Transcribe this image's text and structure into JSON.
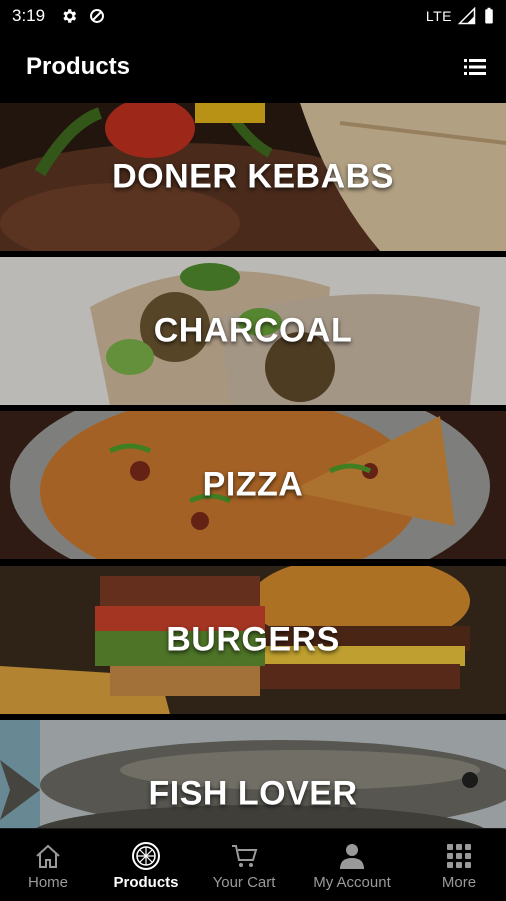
{
  "status": {
    "time": "3:19",
    "network": "LTE"
  },
  "appbar": {
    "title": "Products"
  },
  "categories": [
    {
      "label": "DONER KEBABS"
    },
    {
      "label": "CHARCOAL"
    },
    {
      "label": "PIZZA"
    },
    {
      "label": "BURGERS"
    },
    {
      "label": "FISH LOVER"
    }
  ],
  "nav": {
    "home": "Home",
    "products": "Products",
    "cart": "Your Cart",
    "account": "My Account",
    "more": "More"
  }
}
